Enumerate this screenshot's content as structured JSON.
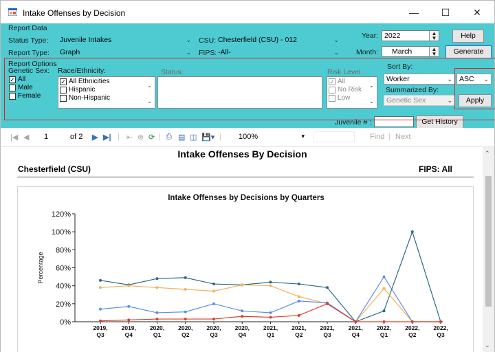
{
  "window": {
    "title": "Intake Offenses by Decision",
    "minimize": "—",
    "maximize": "☐",
    "close": "✕"
  },
  "report_data": {
    "section_label": "Report Data",
    "status_type_label": "Status Type:",
    "status_type_value": "Juvenile Intakes",
    "report_type_label": "Report Type:",
    "report_type_value": "Graph",
    "csu_label": "CSU:",
    "csu_value": "Chesterfield (CSU) - 012",
    "fips_label": "FIPS:",
    "fips_value": "-All-",
    "year_label": "Year:",
    "year_value": "2022",
    "month_label": "Month:",
    "month_value": "March",
    "help_label": "Help",
    "generate_label": "Generate"
  },
  "report_options": {
    "section_label": "Report Options",
    "genetic_sex_label": "Genetic Sex:",
    "sex_options": [
      {
        "label": "All",
        "checked": true
      },
      {
        "label": "Male",
        "checked": false
      },
      {
        "label": "Female",
        "checked": false
      }
    ],
    "race_label": "Race/Ethnicity:",
    "race_options": [
      {
        "label": "All Ethnicities",
        "checked": true
      },
      {
        "label": "Hispanic",
        "checked": false
      },
      {
        "label": "Non-Hispanic",
        "checked": false
      }
    ],
    "status_label": "Status:",
    "risk_label": "Risk Level",
    "risk_options": [
      {
        "label": "All",
        "checked": true
      },
      {
        "label": "No Risk",
        "checked": false
      },
      {
        "label": "Low",
        "checked": false
      }
    ],
    "sort_by_label": "Sort By:",
    "sort_by_value": "Worker",
    "sort_order_value": "ASC",
    "summarized_by_label": "Summarized By:",
    "summarized_by_value": "Genetic Sex",
    "apply_label": "Apply",
    "juvenile_label": "Juvenile # :",
    "juvenile_value": "",
    "get_history_label": "Get History"
  },
  "toolbar": {
    "page_current": "1",
    "page_of": "of 2",
    "zoom": "100%",
    "find_label": "Find",
    "separator": "|",
    "next_label": "Next"
  },
  "report": {
    "title": "Intake Offenses By Decision",
    "left_header": "Chesterfield (CSU)",
    "right_header": "FIPS: All"
  },
  "colors": {
    "form_bg": "#4ecad1",
    "series_dark_teal": "#2a6a86",
    "series_orange": "#f7b15a",
    "series_blue": "#5b8ee6",
    "series_red": "#d9402b",
    "highlight_red": "#d02a2a"
  },
  "chart_data": {
    "type": "line",
    "title": "Intake Offenses by Decisions by Quarters",
    "ylabel": "Percentage",
    "xlabel": "",
    "ylim": [
      0,
      120
    ],
    "yticks": [
      "0%",
      "20%",
      "40%",
      "60%",
      "80%",
      "100%",
      "120%"
    ],
    "grid": false,
    "categories": [
      [
        "2019,",
        "Q3"
      ],
      [
        "2019,",
        "Q4"
      ],
      [
        "2020,",
        "Q1"
      ],
      [
        "2020,",
        "Q2"
      ],
      [
        "2020,",
        "Q3"
      ],
      [
        "2020,",
        "Q4"
      ],
      [
        "2021,",
        "Q1"
      ],
      [
        "2021,",
        "Q2"
      ],
      [
        "2021,",
        "Q3"
      ],
      [
        "2021,",
        "Q4"
      ],
      [
        "2022,",
        "Q1"
      ],
      [
        "2022,",
        "Q2"
      ],
      [
        "2022,",
        "Q3"
      ]
    ],
    "series": [
      {
        "color": "#2a6a86",
        "values": [
          46,
          41,
          48,
          49,
          42,
          41,
          44,
          42,
          38,
          0,
          12,
          100,
          0
        ]
      },
      {
        "color": "#f7b15a",
        "values": [
          38,
          40,
          38,
          36,
          34,
          41,
          40,
          28,
          20,
          0,
          37,
          0,
          0
        ]
      },
      {
        "color": "#5b8ee6",
        "values": [
          14,
          17,
          10,
          11,
          20,
          12,
          10,
          23,
          21,
          0,
          50,
          0,
          0
        ]
      },
      {
        "color": "#d9402b",
        "values": [
          1,
          2,
          3,
          3,
          3,
          6,
          5,
          7,
          20,
          0,
          0,
          0,
          0
        ]
      }
    ]
  }
}
